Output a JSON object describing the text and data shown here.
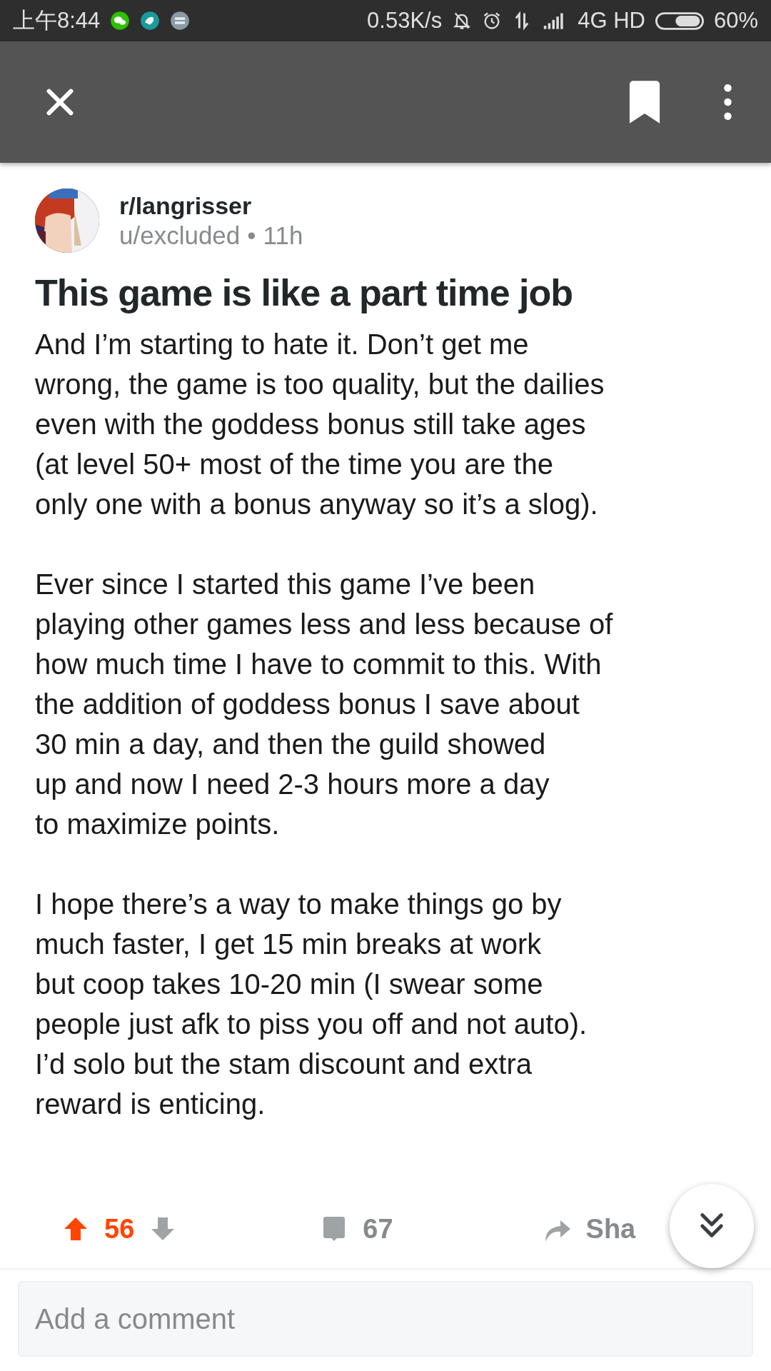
{
  "status_bar": {
    "time": "上午8:44",
    "speed": "0.53K/s",
    "network": "4G HD",
    "battery": "60%"
  },
  "post": {
    "subreddit": "r/langrisser",
    "author": "u/excluded",
    "separator": "•",
    "age": "11h",
    "title": "This game is like a part time job",
    "paragraphs": [
      [
        "And I’m starting to hate it. Don’t get me",
        "wrong, the game is too quality, but the dailies",
        "even with the goddess bonus still take ages",
        "(at level 50+ most of the time you are the",
        "only one with a bonus anyway so it’s a slog)."
      ],
      [
        "Ever since I started this game I’ve been",
        "playing other games less and less because of",
        "how much time I have to commit to this. With",
        "the addition of goddess bonus I save about",
        "30 min a day, and then the guild showed",
        "up and now I need 2-3 hours more a day",
        "to maximize points."
      ],
      [
        "I hope there’s a way to make things go by",
        "much faster, I get 15 min breaks at work",
        "but coop takes 10-20 min (I swear some",
        "people just afk to piss you off and not auto).",
        "I’d solo but the stam  discount and extra",
        "reward is enticing."
      ]
    ],
    "votes": "56",
    "upvoted": true,
    "comments": "67",
    "share": "Sha"
  },
  "comment_field": {
    "placeholder": "Add a comment"
  }
}
